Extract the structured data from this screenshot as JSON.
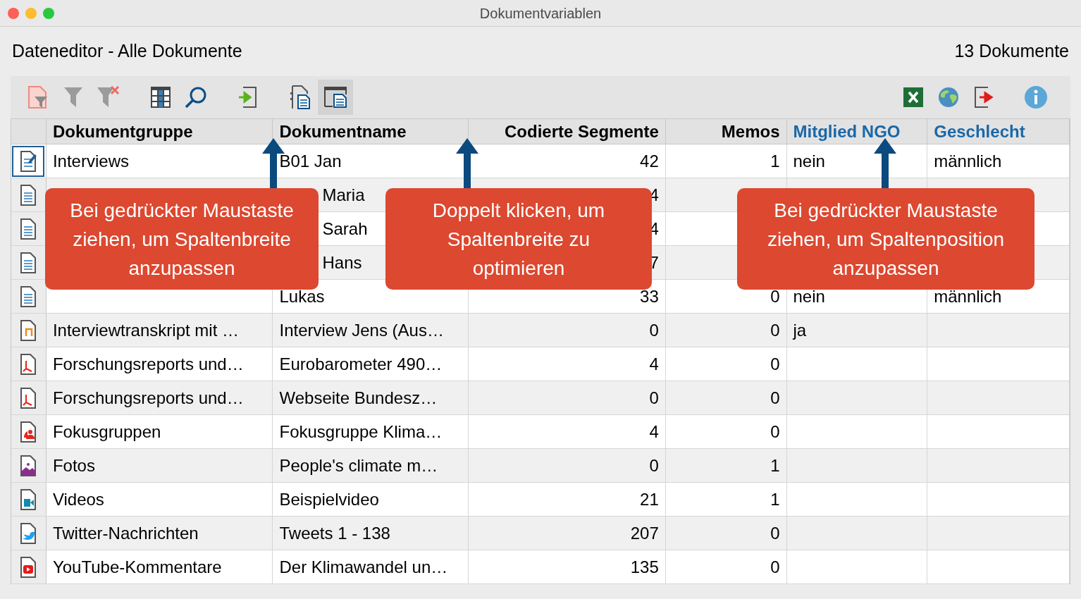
{
  "window": {
    "title": "Dokumentvariablen"
  },
  "header": {
    "title": "Dateneditor - Alle Dokumente",
    "count": "13 Dokumente"
  },
  "toolbar": {
    "left": [
      {
        "kind": "filter-doc",
        "selected": false
      },
      {
        "kind": "filter",
        "selected": false
      },
      {
        "kind": "filter-clear",
        "selected": false
      },
      {
        "kind": "gap"
      },
      {
        "kind": "table",
        "selected": false
      },
      {
        "kind": "search",
        "selected": false
      },
      {
        "kind": "gap"
      },
      {
        "kind": "import",
        "selected": false
      },
      {
        "kind": "gap"
      },
      {
        "kind": "doc-list",
        "selected": false
      },
      {
        "kind": "doc-window",
        "selected": true
      }
    ],
    "right": [
      {
        "kind": "excel",
        "selected": false
      },
      {
        "kind": "globe",
        "selected": false
      },
      {
        "kind": "export",
        "selected": false
      },
      {
        "kind": "gap"
      },
      {
        "kind": "info",
        "selected": false
      }
    ]
  },
  "table": {
    "columns": [
      {
        "label": "Dokumentgruppe",
        "kind": "system"
      },
      {
        "label": "Dokumentname",
        "kind": "system"
      },
      {
        "label": "Codierte Segmente",
        "kind": "system"
      },
      {
        "label": "Memos",
        "kind": "system"
      },
      {
        "label": "Mitglied NGO",
        "kind": "variable"
      },
      {
        "label": "Geschlecht",
        "kind": "variable"
      }
    ],
    "rows": [
      {
        "kind": "text-edit",
        "selected": true,
        "cells": [
          "Interviews",
          "B01 Jan",
          "42",
          "1",
          "nein",
          "männlich"
        ]
      },
      {
        "kind": "text",
        "selected": false,
        "cells": [
          "",
          "Maria",
          "4",
          "",
          "",
          ""
        ]
      },
      {
        "kind": "text",
        "selected": false,
        "cells": [
          "",
          "Sarah",
          "4",
          "",
          "",
          ""
        ]
      },
      {
        "kind": "text",
        "selected": false,
        "cells": [
          "",
          "Hans",
          "7",
          "",
          "",
          ""
        ]
      },
      {
        "kind": "text",
        "selected": false,
        "cells": [
          "",
          "Lukas",
          "33",
          "0",
          "nein",
          "männlich"
        ]
      },
      {
        "kind": "audio",
        "selected": false,
        "cells": [
          "Interviewtranskript mit …",
          "Interview Jens (Aus…",
          "0",
          "0",
          "ja",
          ""
        ]
      },
      {
        "kind": "pdf",
        "selected": false,
        "cells": [
          "Forschungsreports und…",
          "Eurobarometer 490…",
          "4",
          "0",
          "",
          ""
        ]
      },
      {
        "kind": "pdf",
        "selected": false,
        "cells": [
          "Forschungsreports und…",
          "Webseite Bundesz…",
          "0",
          "0",
          "",
          ""
        ]
      },
      {
        "kind": "focus",
        "selected": false,
        "cells": [
          "Fokusgruppen",
          "Fokusgruppe Klima…",
          "4",
          "0",
          "",
          ""
        ]
      },
      {
        "kind": "image",
        "selected": false,
        "cells": [
          "Fotos",
          "People's climate m…",
          "0",
          "1",
          "",
          ""
        ]
      },
      {
        "kind": "video",
        "selected": false,
        "cells": [
          "Videos",
          "Beispielvideo",
          "21",
          "1",
          "",
          ""
        ]
      },
      {
        "kind": "twitter",
        "selected": false,
        "cells": [
          "Twitter-Nachrichten",
          "Tweets 1 - 138",
          "207",
          "0",
          "",
          ""
        ]
      },
      {
        "kind": "youtube",
        "selected": false,
        "cells": [
          "YouTube-Kommentare",
          "Der Klimawandel un…",
          "135",
          "0",
          "",
          ""
        ]
      }
    ]
  },
  "callouts": [
    {
      "text": "Bei gedrückter Maustaste ziehen, um Spaltenbreite anzupassen"
    },
    {
      "text": "Doppelt klicken, um Spaltenbreite zu optimieren"
    },
    {
      "text": "Bei gedrückter Maustaste ziehen, um Spaltenposition anzupassen"
    }
  ]
}
